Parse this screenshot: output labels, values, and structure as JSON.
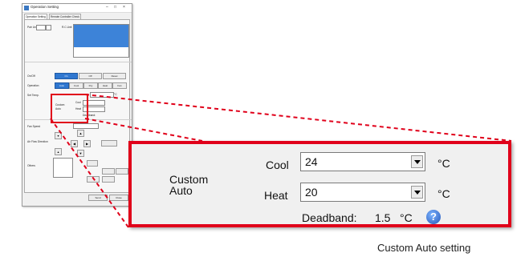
{
  "window": {
    "title": "Operation Setting",
    "tabs": [
      "Operation Setting",
      "Remote Controller Check"
    ],
    "target_label": "Pair Unit",
    "target_value": "1",
    "indoor_label": "R.C.Unit",
    "mode_row_label": "Operation",
    "onoff_row_label": "On/Off",
    "setpoint_row_label": "Set Temp.",
    "fan_row_label": "Fan Speed",
    "louver_row_label": "Air Flow Direction",
    "other_label": "Others",
    "onoff_buttons": [
      "On",
      "Off",
      "Reset"
    ],
    "mode_buttons": [
      "Auto",
      "Cool",
      "Dry",
      "Heat",
      "Fan"
    ],
    "bottom_buttons": [
      "Send",
      "Close"
    ]
  },
  "custom_auto": {
    "title_line1": "Custom",
    "title_line2": "Auto",
    "cool_label": "Cool",
    "cool_value": "24",
    "heat_label": "Heat",
    "heat_value": "20",
    "unit": "°C",
    "deadband_label": "Deadband:",
    "deadband_value": "1.5",
    "deadband_unit": "°C",
    "help_glyph": "?"
  },
  "caption": "Custom Auto setting",
  "colors": {
    "highlight": "#e0001a",
    "selection": "#3d83d8",
    "help": "#2456b8"
  },
  "icons": [
    "help-icon",
    "dropdown-arrow-icon",
    "window-app-icon"
  ]
}
